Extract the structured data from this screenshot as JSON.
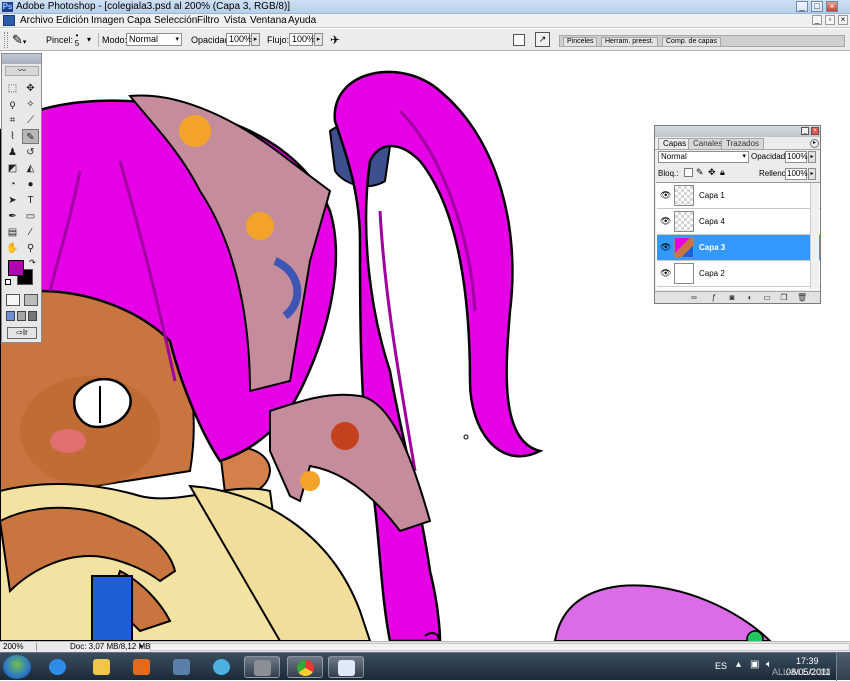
{
  "window": {
    "title": "Adobe Photoshop - [colegiala3.psd al 200% (Capa 3, RGB/8)]"
  },
  "menu": [
    "Archivo",
    "Edición",
    "Imagen",
    "Capa",
    "Selección",
    "Filtro",
    "Vista",
    "Ventana",
    "Ayuda"
  ],
  "options": {
    "brush_label": "Pincel:",
    "brush_size": "5",
    "mode_label": "Modo:",
    "mode_value": "Normal",
    "opacity_label": "Opacidad:",
    "opacity_value": "100%",
    "flow_label": "Flujo:",
    "flow_value": "100%"
  },
  "palette_well": [
    "Pinceles",
    "Herram. preest.",
    "Comp. de capas"
  ],
  "layers_panel": {
    "tabs": [
      "Capas",
      "Canales",
      "Trazados"
    ],
    "blend_mode": "Normal",
    "opacity_label": "Opacidad:",
    "opacity_value": "100%",
    "lock_label": "Bloq.:",
    "fill_label": "Relleno:",
    "fill_value": "100%",
    "layers": [
      {
        "name": "Capa 1",
        "visible": true,
        "active": false
      },
      {
        "name": "Capa 4",
        "visible": true,
        "active": false
      },
      {
        "name": "Capa 3",
        "visible": true,
        "active": true
      },
      {
        "name": "Capa 2",
        "visible": true,
        "active": false
      }
    ]
  },
  "status": {
    "zoom": "200%",
    "doc": "Doc: 3,07 MB/8,12 MB"
  },
  "taskbar": {
    "lang": "ES",
    "time": "17:39",
    "date": "08/05/2011",
    "watermark": "ALL-ALL.COM"
  },
  "colors": {
    "foreground": "#b000b0",
    "background": "#000000",
    "hair": "#e500e5",
    "selection": "#3399ff"
  }
}
